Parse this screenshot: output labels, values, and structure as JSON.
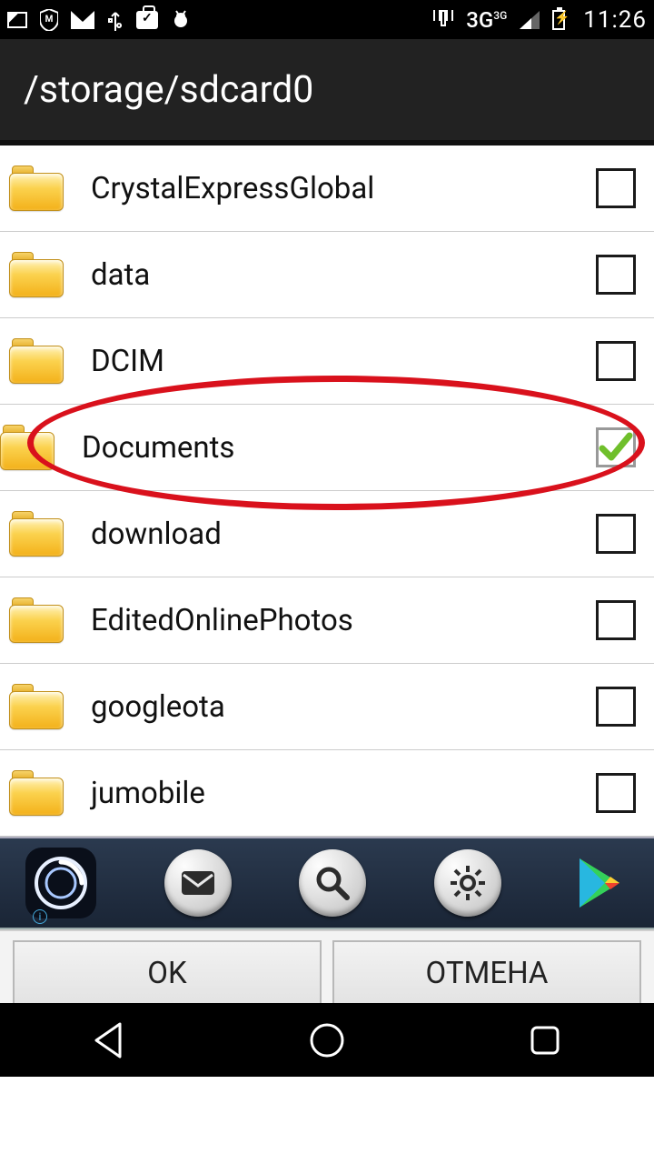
{
  "statusbar": {
    "network_label": "3G",
    "network_sup": "3G",
    "clock": "11:26"
  },
  "titlebar": {
    "path": "/storage/sdcard0"
  },
  "folders": [
    {
      "name": "CrystalExpressGlobal",
      "checked": false
    },
    {
      "name": "data",
      "checked": false
    },
    {
      "name": "DCIM",
      "checked": false
    },
    {
      "name": "Documents",
      "checked": true
    },
    {
      "name": "download",
      "checked": false
    },
    {
      "name": "EditedOnlinePhotos",
      "checked": false
    },
    {
      "name": "googleota",
      "checked": false
    },
    {
      "name": "jumobile",
      "checked": false
    }
  ],
  "actions": {
    "ok": "OK",
    "cancel": "ОТМЕНА"
  },
  "annotation": {
    "highlighted_folder": "Documents"
  }
}
